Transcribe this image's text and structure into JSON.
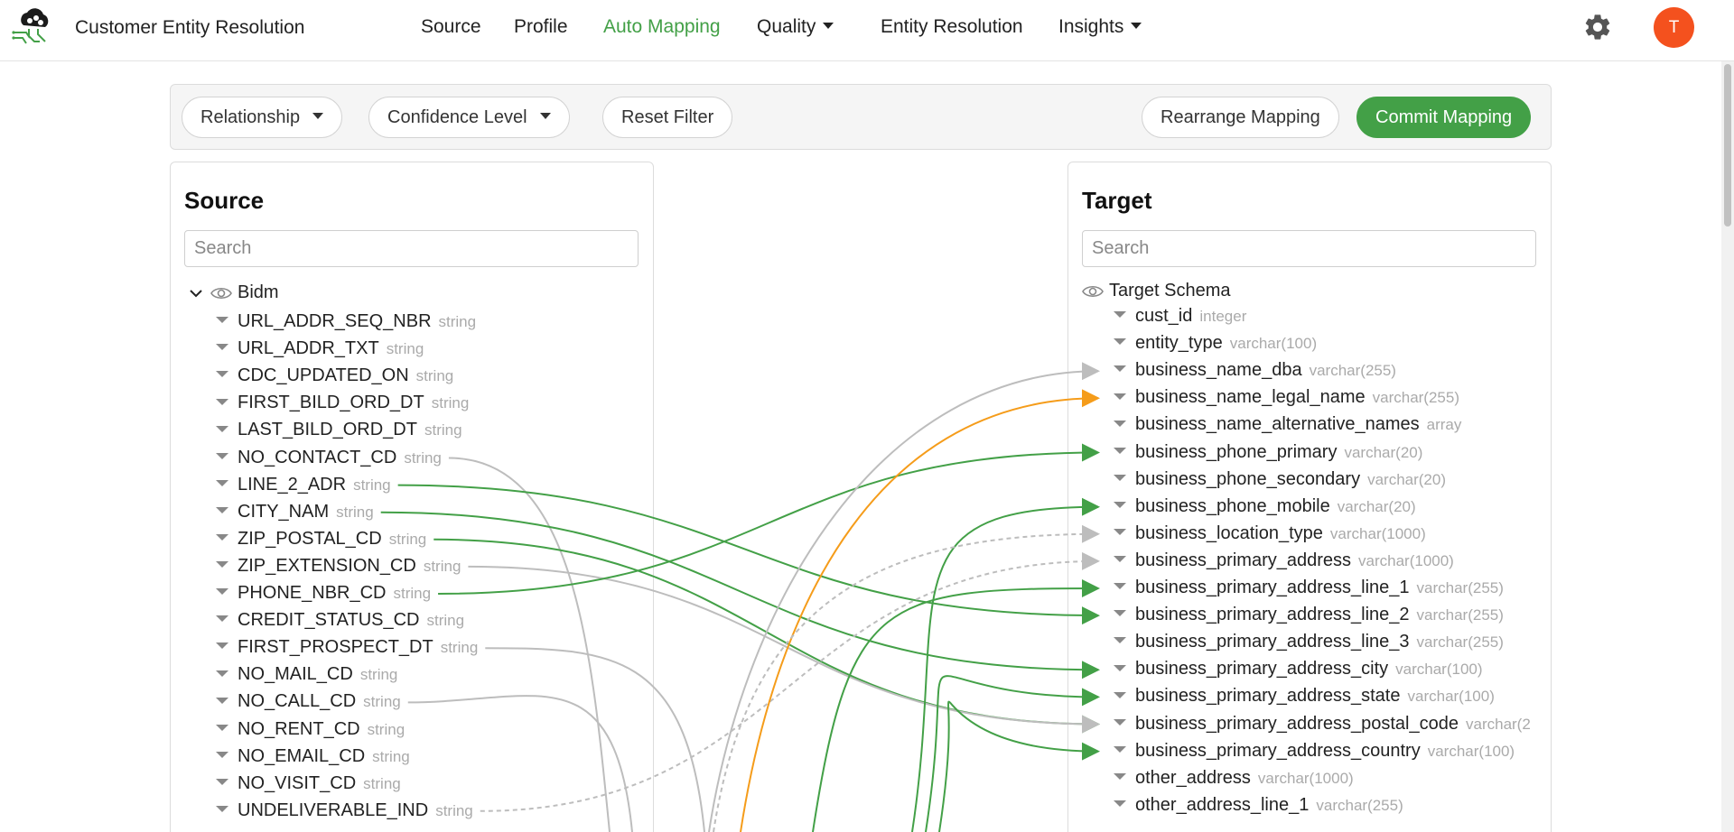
{
  "app": {
    "title": "Customer Entity Resolution",
    "avatar_initial": "T"
  },
  "nav": {
    "items": [
      {
        "label": "Source",
        "active": false,
        "dropdown": false
      },
      {
        "label": "Profile",
        "active": false,
        "dropdown": false
      },
      {
        "label": "Auto Mapping",
        "active": true,
        "dropdown": false
      },
      {
        "label": "Quality",
        "active": false,
        "dropdown": true
      },
      {
        "label": "Entity Resolution",
        "active": false,
        "dropdown": false
      },
      {
        "label": "Insights",
        "active": false,
        "dropdown": true
      }
    ]
  },
  "filters": {
    "relationship": "Relationship",
    "confidence": "Confidence Level",
    "reset": "Reset Filter",
    "rearrange": "Rearrange Mapping",
    "commit": "Commit Mapping"
  },
  "source": {
    "title": "Source",
    "search_placeholder": "Search",
    "schema": "Bidm",
    "fields": [
      {
        "name": "URL_ADDR_SEQ_NBR",
        "type": "string"
      },
      {
        "name": "URL_ADDR_TXT",
        "type": "string"
      },
      {
        "name": "CDC_UPDATED_ON",
        "type": "string"
      },
      {
        "name": "FIRST_BILD_ORD_DT",
        "type": "string"
      },
      {
        "name": "LAST_BILD_ORD_DT",
        "type": "string"
      },
      {
        "name": "NO_CONTACT_CD",
        "type": "string"
      },
      {
        "name": "LINE_2_ADR",
        "type": "string"
      },
      {
        "name": "CITY_NAM",
        "type": "string"
      },
      {
        "name": "ZIP_POSTAL_CD",
        "type": "string"
      },
      {
        "name": "ZIP_EXTENSION_CD",
        "type": "string"
      },
      {
        "name": "PHONE_NBR_CD",
        "type": "string"
      },
      {
        "name": "CREDIT_STATUS_CD",
        "type": "string"
      },
      {
        "name": "FIRST_PROSPECT_DT",
        "type": "string"
      },
      {
        "name": "NO_MAIL_CD",
        "type": "string"
      },
      {
        "name": "NO_CALL_CD",
        "type": "string"
      },
      {
        "name": "NO_RENT_CD",
        "type": "string"
      },
      {
        "name": "NO_EMAIL_CD",
        "type": "string"
      },
      {
        "name": "NO_VISIT_CD",
        "type": "string"
      },
      {
        "name": "UNDELIVERABLE_IND",
        "type": "string"
      }
    ]
  },
  "target": {
    "title": "Target",
    "search_placeholder": "Search",
    "schema": "Target Schema",
    "fields": [
      {
        "name": "cust_id",
        "type": "integer"
      },
      {
        "name": "entity_type",
        "type": "varchar(100)"
      },
      {
        "name": "business_name_dba",
        "type": "varchar(255)"
      },
      {
        "name": "business_name_legal_name",
        "type": "varchar(255)"
      },
      {
        "name": "business_name_alternative_names",
        "type": "array"
      },
      {
        "name": "business_phone_primary",
        "type": "varchar(20)"
      },
      {
        "name": "business_phone_secondary",
        "type": "varchar(20)"
      },
      {
        "name": "business_phone_mobile",
        "type": "varchar(20)"
      },
      {
        "name": "business_location_type",
        "type": "varchar(1000)"
      },
      {
        "name": "business_primary_address",
        "type": "varchar(1000)"
      },
      {
        "name": "business_primary_address_line_1",
        "type": "varchar(255)"
      },
      {
        "name": "business_primary_address_line_2",
        "type": "varchar(255)"
      },
      {
        "name": "business_primary_address_line_3",
        "type": "varchar(255)"
      },
      {
        "name": "business_primary_address_city",
        "type": "varchar(100)"
      },
      {
        "name": "business_primary_address_state",
        "type": "varchar(100)"
      },
      {
        "name": "business_primary_address_postal_code",
        "type": "varchar(2"
      },
      {
        "name": "business_primary_address_country",
        "type": "varchar(100)"
      },
      {
        "name": "other_address",
        "type": "varchar(1000)"
      },
      {
        "name": "other_address_line_1",
        "type": "varchar(255)"
      }
    ]
  },
  "mapping_colors": {
    "high": "#43a047",
    "medium": "#f59c1a",
    "low": "#bdbdbd"
  },
  "mappings": [
    {
      "from": "NO_CONTACT_CD",
      "to_offscreen": true,
      "confidence": "low",
      "style": "solid"
    },
    {
      "from": "LINE_2_ADR",
      "to": "business_primary_address_line_2",
      "confidence": "high",
      "style": "solid"
    },
    {
      "from": "CITY_NAM",
      "to": "business_primary_address_city",
      "confidence": "high",
      "style": "solid"
    },
    {
      "from": "ZIP_POSTAL_CD",
      "to": "business_primary_address_postal_code",
      "confidence": "high",
      "style": "solid"
    },
    {
      "from": "ZIP_EXTENSION_CD",
      "to": "business_primary_address_postal_code",
      "confidence": "low",
      "style": "solid"
    },
    {
      "from": "PHONE_NBR_CD",
      "to": "business_phone_primary",
      "confidence": "high",
      "style": "solid"
    },
    {
      "from": "FIRST_PROSPECT_DT",
      "to_offscreen": true,
      "confidence": "low",
      "style": "solid"
    },
    {
      "from": "NO_CALL_CD",
      "to_offscreen": true,
      "confidence": "low",
      "style": "solid"
    },
    {
      "from": "UNDELIVERABLE_IND",
      "to": "business_primary_address",
      "confidence": "low",
      "style": "dashed"
    },
    {
      "from_offscreen": true,
      "to": "business_name_dba",
      "confidence": "low",
      "style": "solid"
    },
    {
      "from_offscreen": true,
      "to": "business_name_legal_name",
      "confidence": "medium",
      "style": "solid"
    },
    {
      "from_offscreen": true,
      "to": "business_phone_mobile",
      "confidence": "high",
      "style": "solid"
    },
    {
      "from_offscreen": true,
      "to": "business_location_type",
      "confidence": "low",
      "style": "dashed"
    },
    {
      "from_offscreen": true,
      "to": "business_primary_address_line_1",
      "confidence": "high",
      "style": "solid"
    },
    {
      "from_offscreen": true,
      "to": "business_primary_address_state",
      "confidence": "high",
      "style": "solid"
    },
    {
      "from_offscreen": true,
      "to": "business_primary_address_country",
      "confidence": "high",
      "style": "solid"
    }
  ]
}
